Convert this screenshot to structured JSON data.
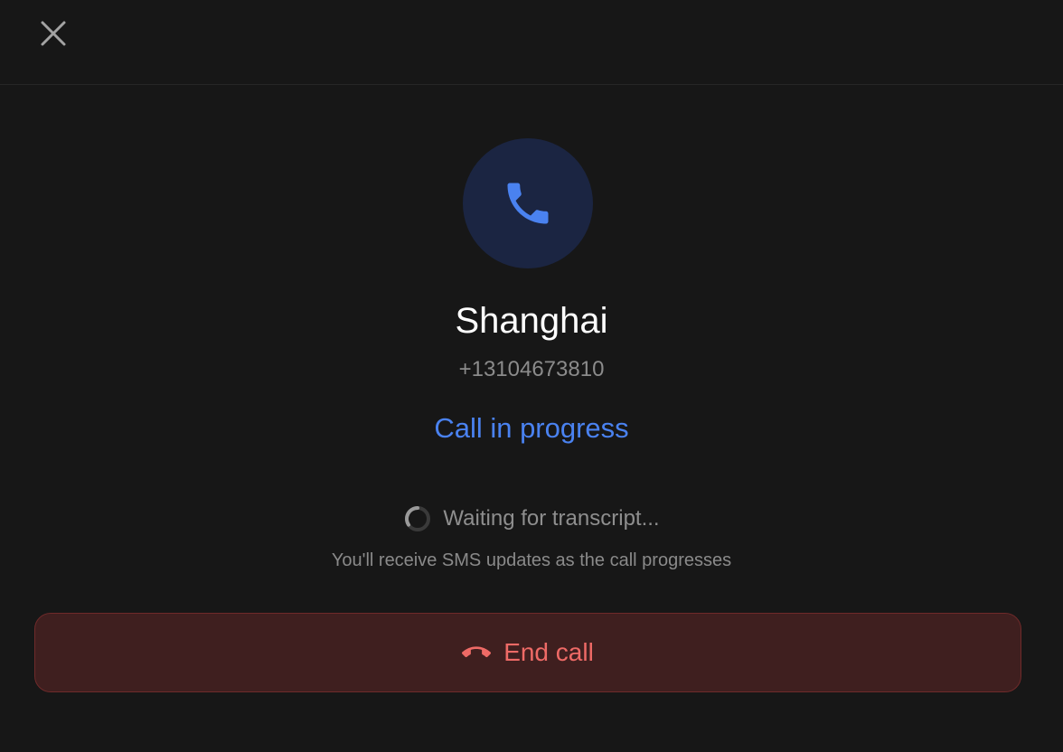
{
  "header": {
    "close_icon": "close-icon"
  },
  "contact": {
    "avatar_icon": "phone-icon",
    "name": "Shanghai",
    "number": "+13104673810"
  },
  "call": {
    "status": "Call in progress",
    "transcript_status": "Waiting for transcript...",
    "sms_note": "You'll receive SMS updates as the call progresses",
    "end_call_label": "End call",
    "end_call_icon": "hang-up-icon"
  },
  "colors": {
    "background": "#171717",
    "accent_blue": "#4a82f0",
    "avatar_bg": "#1b2542",
    "danger": "#ee6a66",
    "danger_bg": "#3f1f1f",
    "muted_text": "#8b8b8b"
  }
}
